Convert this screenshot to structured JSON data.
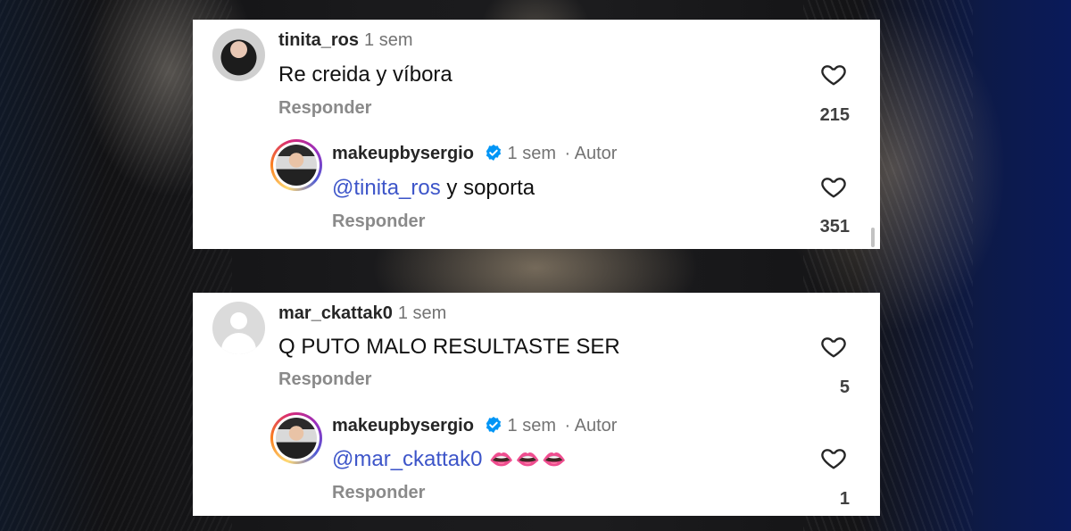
{
  "comments": [
    {
      "username": "tinita_ros",
      "time": "1 sem",
      "text": "Re creida y víbora",
      "reply_label": "Responder",
      "likes": "215",
      "avatar": "profile-photo",
      "reply": {
        "username": "makeupbysergio",
        "time": "1 sem",
        "author_tag": "· Autor",
        "mention": "@tinita_ros",
        "text": " y soporta",
        "reply_label": "Responder",
        "likes": "351"
      }
    },
    {
      "username": "mar_ckattak0",
      "time": "1 sem",
      "text": "Q PUTO MALO RESULTASTE SER",
      "reply_label": "Responder",
      "likes": "5",
      "avatar": "default-avatar",
      "reply": {
        "username": "makeupbysergio",
        "time": "1 sem",
        "author_tag": "· Autor",
        "mention": "@mar_ckattak0",
        "text": "",
        "emoji": "👄👄👄",
        "reply_label": "Responder",
        "likes": "1"
      }
    }
  ],
  "colors": {
    "verified": "#0095f6",
    "mention": "#3d55c9",
    "muted": "#737373"
  },
  "icons": [
    "heart-icon",
    "verified-badge-icon",
    "default-avatar-icon"
  ]
}
